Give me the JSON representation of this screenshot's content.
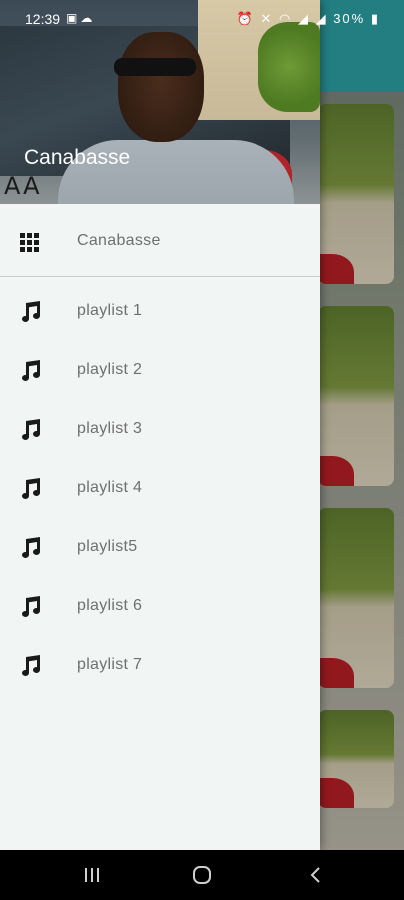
{
  "status_bar": {
    "time": "12:39",
    "left_icons": [
      "image-icon",
      "cloud-icon"
    ],
    "right_icons": [
      "alarm-icon",
      "mute-icon",
      "wifi-icon",
      "signal-icon",
      "signal-icon"
    ],
    "battery": "30%"
  },
  "drawer": {
    "header_title": "Canabasse",
    "plate_text": "AA",
    "home_item": {
      "label": "Canabasse",
      "icon": "grid-icon"
    },
    "items": [
      {
        "label": "playlist 1",
        "icon": "music-note-icon"
      },
      {
        "label": "playlist 2",
        "icon": "music-note-icon"
      },
      {
        "label": "playlist 3",
        "icon": "music-note-icon"
      },
      {
        "label": "playlist 4",
        "icon": "music-note-icon"
      },
      {
        "label": "playlist5",
        "icon": "music-note-icon"
      },
      {
        "label": "playlist 6",
        "icon": "music-note-icon"
      },
      {
        "label": "playlist 7",
        "icon": "music-note-icon"
      }
    ]
  },
  "navigation_bar": {
    "buttons": [
      "recent-apps-icon",
      "home-icon",
      "back-icon"
    ]
  },
  "colors": {
    "drawer_bg": "#f1f5f4",
    "label_text": "#707070",
    "toolbar_teal": "#2a9a9e",
    "nav_bg": "#000000"
  }
}
